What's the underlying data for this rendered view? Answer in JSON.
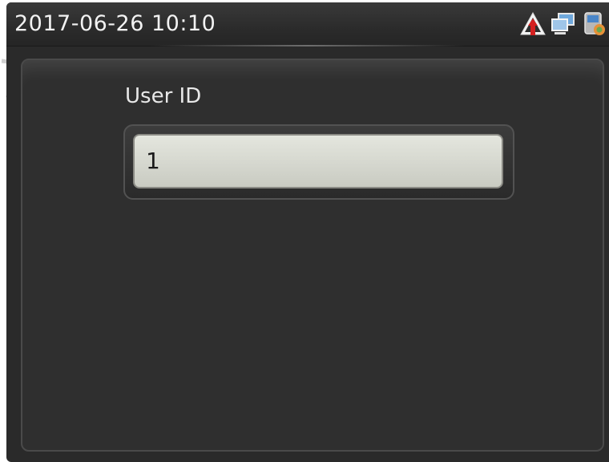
{
  "status_bar": {
    "datetime": "2017-06-26 10:10",
    "icons": [
      "alert-icon",
      "network-icon",
      "device-icon"
    ]
  },
  "form": {
    "field_label": "User ID",
    "field_value": "1"
  },
  "colors": {
    "background": "#2a2a2a",
    "panel": "#2f2f2f",
    "input_fill": "#d8dad2",
    "alert_red": "#d42020"
  }
}
